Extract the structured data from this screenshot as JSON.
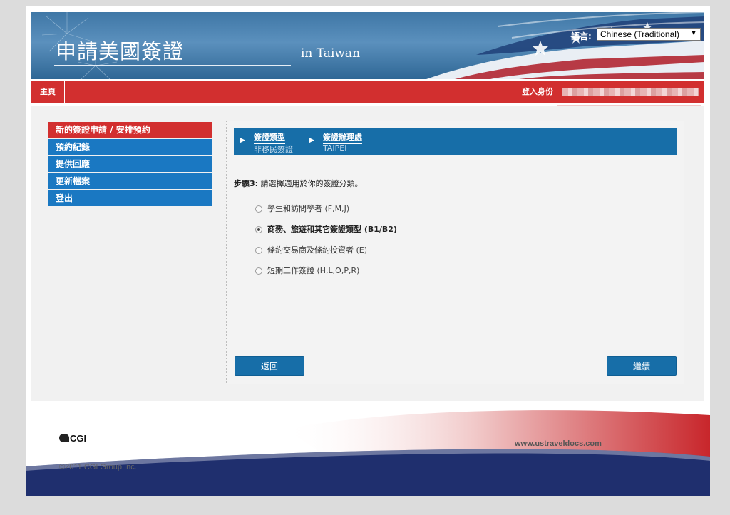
{
  "header": {
    "site_title": "申請美國簽證",
    "site_subtitle": "in Taiwan",
    "language_label": "語言:",
    "language_value": "Chinese (Traditional)"
  },
  "navbar": {
    "home": "主頁",
    "login_label": "登入身份"
  },
  "sidebar": {
    "items": [
      {
        "label": "新的簽證申請 / 安排預約",
        "active": true
      },
      {
        "label": "預約紀錄",
        "active": false
      },
      {
        "label": "提供回應",
        "active": false
      },
      {
        "label": "更新檔案",
        "active": false
      },
      {
        "label": "登出",
        "active": false
      }
    ]
  },
  "progress": {
    "steps": [
      {
        "title": "簽證類型",
        "value": "非移民簽證"
      },
      {
        "title": "簽證辦理處",
        "value": "TAIPEI"
      }
    ]
  },
  "step": {
    "prefix": "步驟3:",
    "instruction": " 請選擇適用於你的簽證分類。"
  },
  "options": [
    {
      "label": "學生和訪問學者",
      "code": " (F,M,J)",
      "selected": false
    },
    {
      "label": "商務、旅遊和其它簽證類型",
      "code": " (B1/B2)",
      "selected": true
    },
    {
      "label": "條約交易商及條約投資者",
      "code": " (E)",
      "selected": false
    },
    {
      "label": "短期工作簽證",
      "code": " (H,L,O,P,R)",
      "selected": false
    }
  ],
  "buttons": {
    "back": "返回",
    "continue": "繼續"
  },
  "footer": {
    "logo_text": "CGI",
    "copyright": "©2011 CGI Group Inc.",
    "site_url": "www.ustraveldocs.com"
  },
  "colors": {
    "nav_red": "#d22f2f",
    "nav_blue": "#1a78c2",
    "progress_blue": "#176ea8",
    "footer_navy": "#1f2f6e"
  }
}
